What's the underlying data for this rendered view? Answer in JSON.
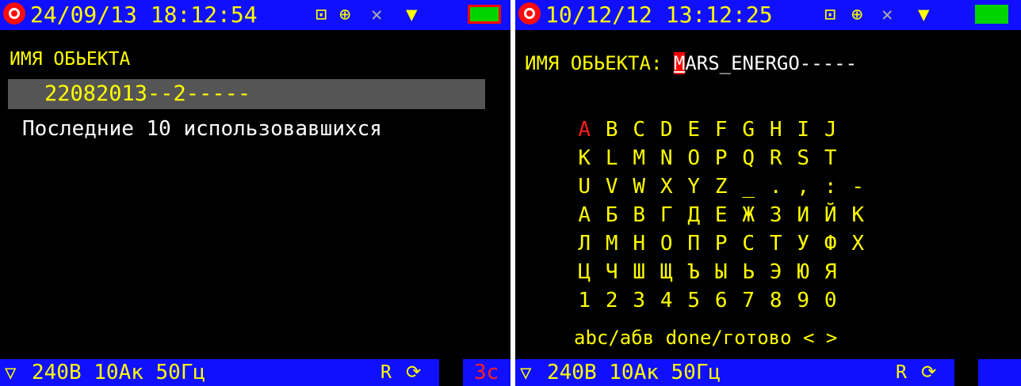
{
  "left": {
    "clock": "24/09/13 18:12:54",
    "field_label": "ИМЯ ОБЬЕКТА",
    "selected_value": "22082013--2-----",
    "recent_label": "Последние 10 использовавшихся",
    "status": "240В 10Ак 50Гц",
    "timer": "3с"
  },
  "right": {
    "clock": "10/12/12 13:12:25",
    "field_label": "ИМЯ ОБЬЕКТА:",
    "cursor_char": "M",
    "value_rest": "ARS_ENERGO-----",
    "keyboard_rows": [
      [
        "A",
        "B",
        "C",
        "D",
        "E",
        "F",
        "G",
        "H",
        "I",
        "J"
      ],
      [
        "K",
        "L",
        "M",
        "N",
        "O",
        "P",
        "Q",
        "R",
        "S",
        "T"
      ],
      [
        "U",
        "V",
        "W",
        "X",
        "Y",
        "Z",
        "_",
        ".",
        ",",
        ":",
        "-"
      ],
      [
        "А",
        "Б",
        "В",
        "Г",
        "Д",
        "Е",
        "Ж",
        "З",
        "И",
        "Й",
        "К"
      ],
      [
        "Л",
        "М",
        "Н",
        "О",
        "П",
        "Р",
        "С",
        "Т",
        "У",
        "Ф",
        "Х"
      ],
      [
        "Ц",
        "Ч",
        "Ш",
        "Щ",
        "Ъ",
        "Ы",
        "Ь",
        "Э",
        "Ю",
        "Я"
      ],
      [
        "1",
        "2",
        "3",
        "4",
        "5",
        "6",
        "7",
        "8",
        "9",
        "0"
      ]
    ],
    "bottom_keys": "abc/aбв done/готово < >",
    "status": "240В 10Ак 50Гц"
  },
  "icons": [
    "logo-icon",
    "network-icon",
    "usb-icon",
    "satellite-icon",
    "plug-icon",
    "battery-icon",
    "filter-icon",
    "r-icon",
    "refresh-icon"
  ],
  "colors": {
    "bar": "#1010ff",
    "text": "#ffff00",
    "accent": "#ff0000",
    "battery": "#00d400"
  }
}
